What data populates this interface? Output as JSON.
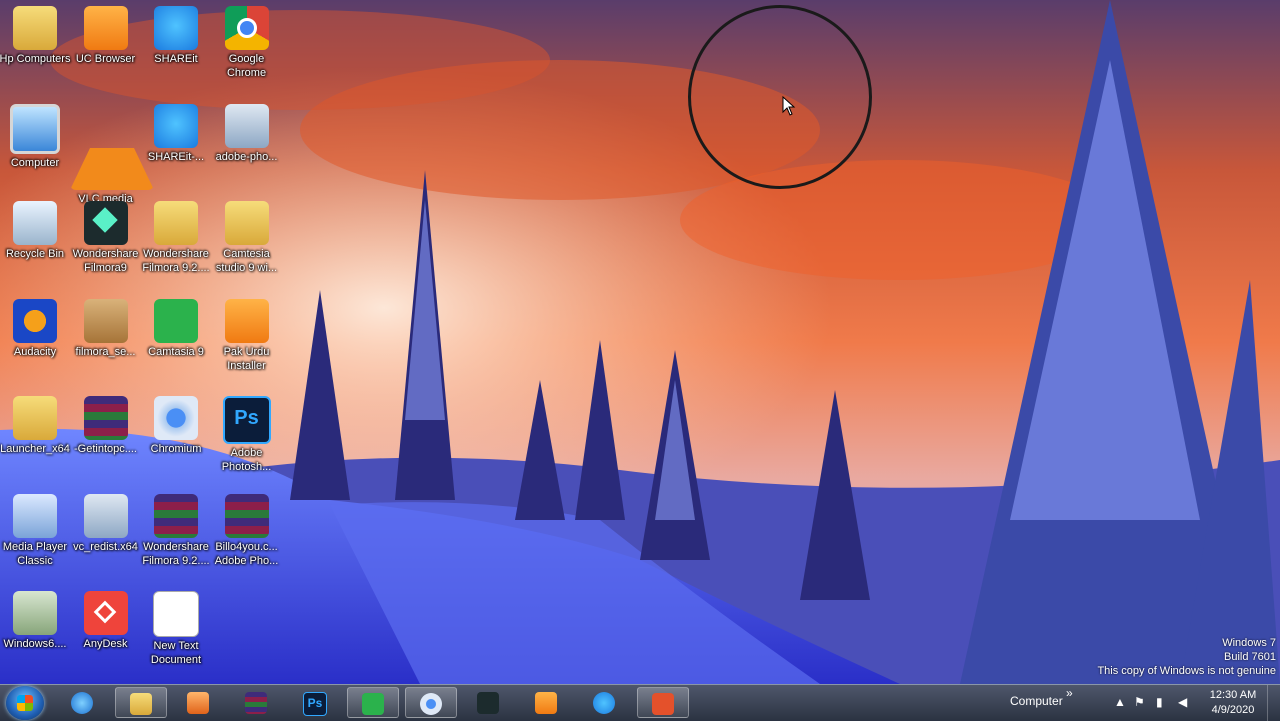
{
  "desktop": {
    "icons": [
      {
        "label": "Hp Computers",
        "icon": "folder-user-icon"
      },
      {
        "label": "UC Browser",
        "icon": "uc-browser-icon"
      },
      {
        "label": "SHAREit",
        "icon": "shareit-icon"
      },
      {
        "label": "Google Chrome",
        "icon": "chrome-icon"
      },
      {
        "label": "Computer",
        "icon": "computer-icon"
      },
      {
        "label": "VLC media player",
        "icon": "vlc-icon"
      },
      {
        "label": "SHAREit-...",
        "icon": "shareit-icon"
      },
      {
        "label": "adobe-pho...",
        "icon": "installer-icon"
      },
      {
        "label": "Recycle Bin",
        "icon": "recycle-bin-icon"
      },
      {
        "label": "Wondershare Filmora9",
        "icon": "filmora-icon"
      },
      {
        "label": "Wondershare Filmora 9.2....",
        "icon": "folder-icon"
      },
      {
        "label": "Camtesia studio 9 wi...",
        "icon": "folder-icon"
      },
      {
        "label": "Audacity",
        "icon": "audacity-icon"
      },
      {
        "label": "filmora_se...",
        "icon": "installer-box-icon"
      },
      {
        "label": "Camtasia 9",
        "icon": "camtasia-icon"
      },
      {
        "label": "Pak Urdu Installer",
        "icon": "uc-browser-icon"
      },
      {
        "label": "Launcher_x64",
        "icon": "folder-icon"
      },
      {
        "label": "-Getintopc....",
        "icon": "winrar-icon"
      },
      {
        "label": "Chromium",
        "icon": "chromium-icon"
      },
      {
        "label": "Adobe Photosh...",
        "icon": "photoshop-icon"
      },
      {
        "label": "Media Player Classic",
        "icon": "media-player-classic-icon"
      },
      {
        "label": "vc_redist.x64",
        "icon": "installer-icon"
      },
      {
        "label": "Wondershare Filmora 9.2....",
        "icon": "winrar-icon"
      },
      {
        "label": "Billo4you.c... Adobe Pho...",
        "icon": "winrar-icon"
      },
      {
        "label": "Windows6....",
        "icon": "windows-update-icon"
      },
      {
        "label": "AnyDesk",
        "icon": "anydesk-icon"
      },
      {
        "label": "New Text Document",
        "icon": "text-document-icon"
      }
    ]
  },
  "watermark": {
    "line1": "Windows 7",
    "line2": "Build 7601",
    "line3": "This copy of Windows is not genuine"
  },
  "taskbar": {
    "apps": [
      {
        "name": "internet-explorer",
        "icon": "internet-explorer-icon"
      },
      {
        "name": "file-explorer",
        "icon": "folder-icon",
        "active": true
      },
      {
        "name": "media-player",
        "icon": "media-player-icon"
      },
      {
        "name": "winrar",
        "icon": "winrar-icon"
      },
      {
        "name": "photoshop",
        "icon": "photoshop-icon"
      },
      {
        "name": "camtasia",
        "icon": "camtasia-icon",
        "active": true
      },
      {
        "name": "chromium",
        "icon": "chromium-icon",
        "active": true
      },
      {
        "name": "filmora",
        "icon": "filmora-icon"
      },
      {
        "name": "uc-browser",
        "icon": "uc-browser-icon"
      },
      {
        "name": "shareit",
        "icon": "shareit-icon"
      },
      {
        "name": "camtasia-recorder",
        "icon": "camtasia-recorder-icon",
        "active": true
      }
    ],
    "ps_text": "Ps",
    "tray_toolbar_label": "Computer",
    "tray_chevron": "»",
    "time": "12:30 AM",
    "date": "4/9/2020"
  }
}
